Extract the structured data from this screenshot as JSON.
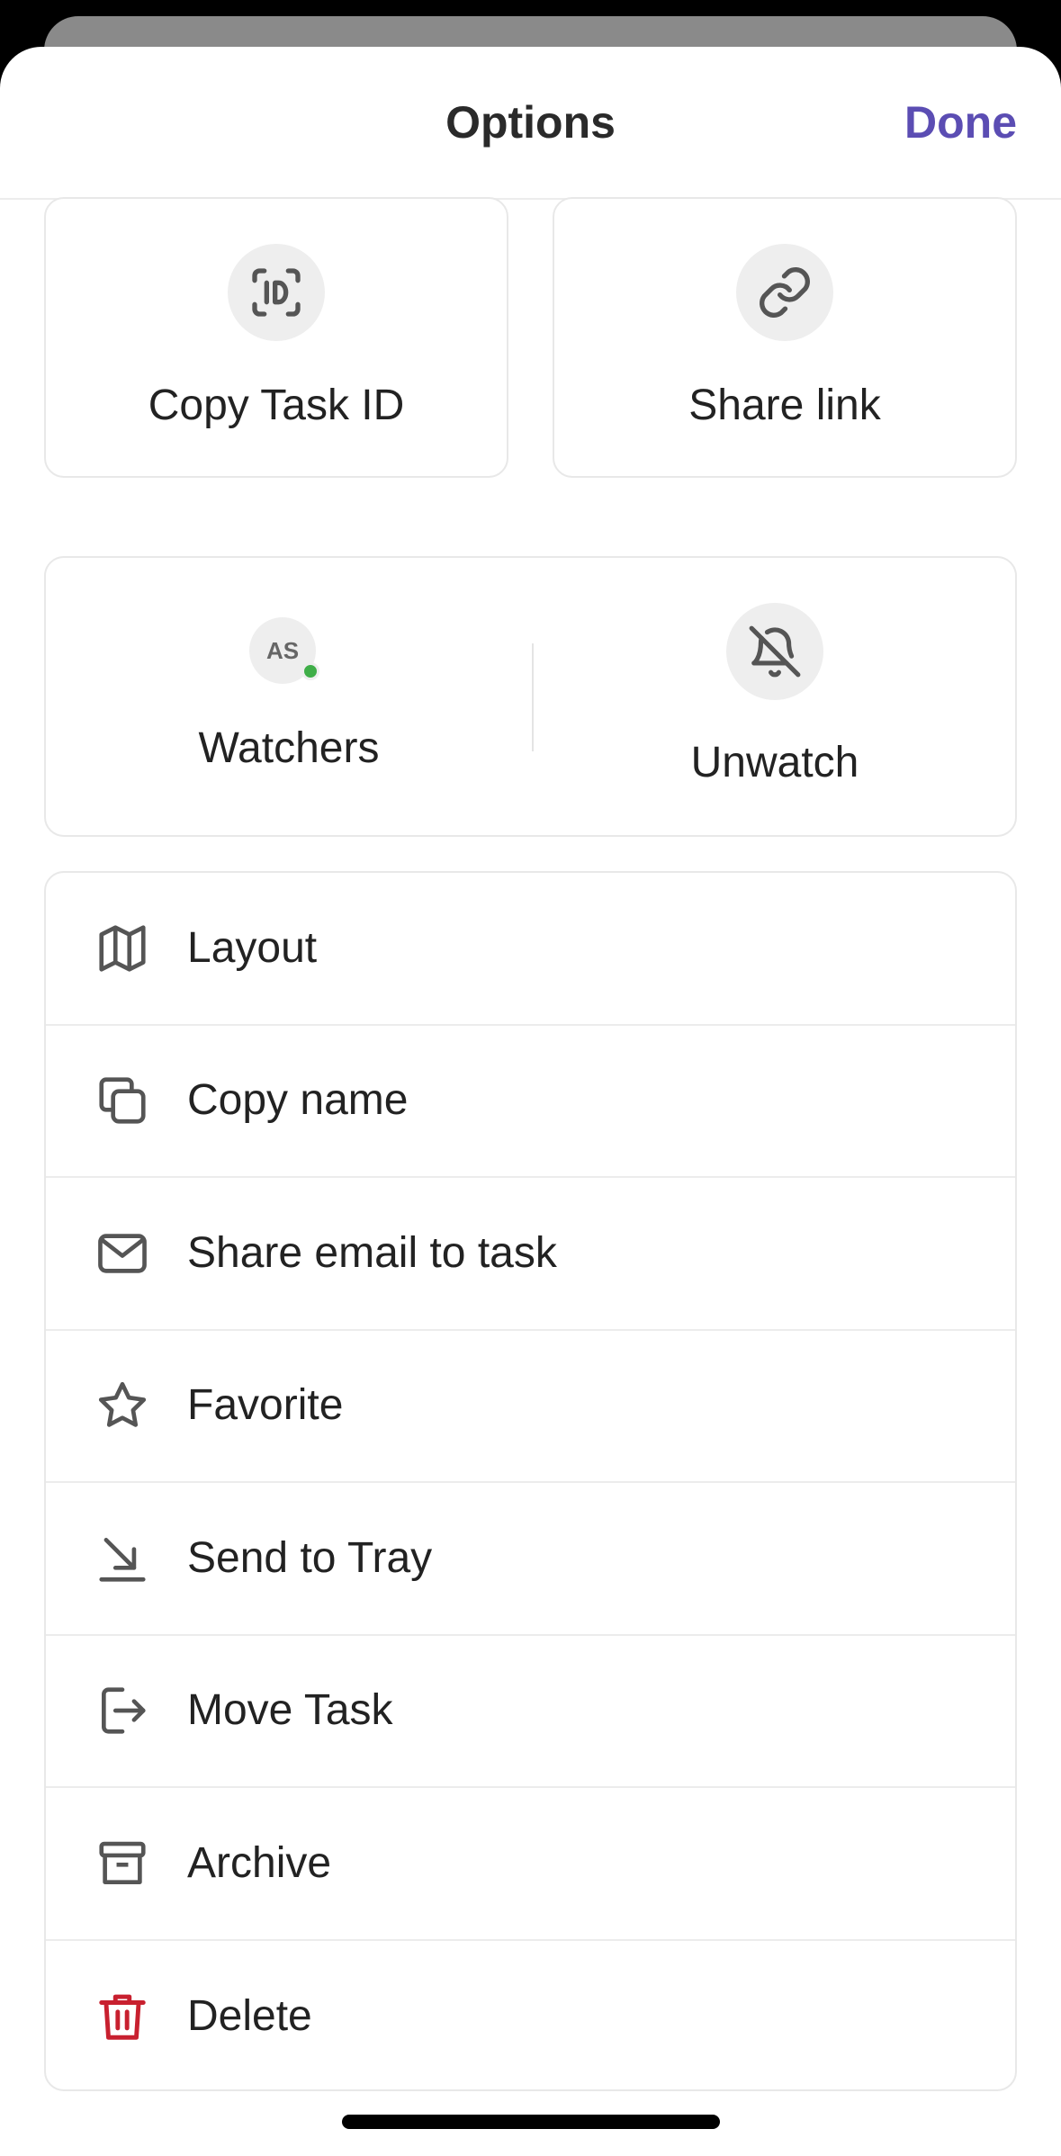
{
  "header": {
    "title": "Options",
    "done_label": "Done"
  },
  "tiles": {
    "copy_task_id": {
      "label": "Copy Task ID",
      "icon": "id-scan-icon"
    },
    "share_link": {
      "label": "Share link",
      "icon": "link-icon"
    }
  },
  "watch": {
    "watchers_label": "Watchers",
    "avatar_initials": "AS",
    "unwatch_label": "Unwatch"
  },
  "menu": {
    "items": [
      {
        "label": "Layout",
        "icon": "map-layout-icon"
      },
      {
        "label": "Copy name",
        "icon": "copy-icon"
      },
      {
        "label": "Share email to task",
        "icon": "mail-icon"
      },
      {
        "label": "Favorite",
        "icon": "star-icon"
      },
      {
        "label": "Send to Tray",
        "icon": "arrow-to-tray-icon"
      },
      {
        "label": "Move Task",
        "icon": "move-out-icon"
      },
      {
        "label": "Archive",
        "icon": "archive-box-icon"
      },
      {
        "label": "Delete",
        "icon": "trash-icon"
      }
    ]
  },
  "colors": {
    "accent": "#5b4db3",
    "danger": "#c8202f",
    "online": "#3fae48",
    "icon": "#555555"
  }
}
